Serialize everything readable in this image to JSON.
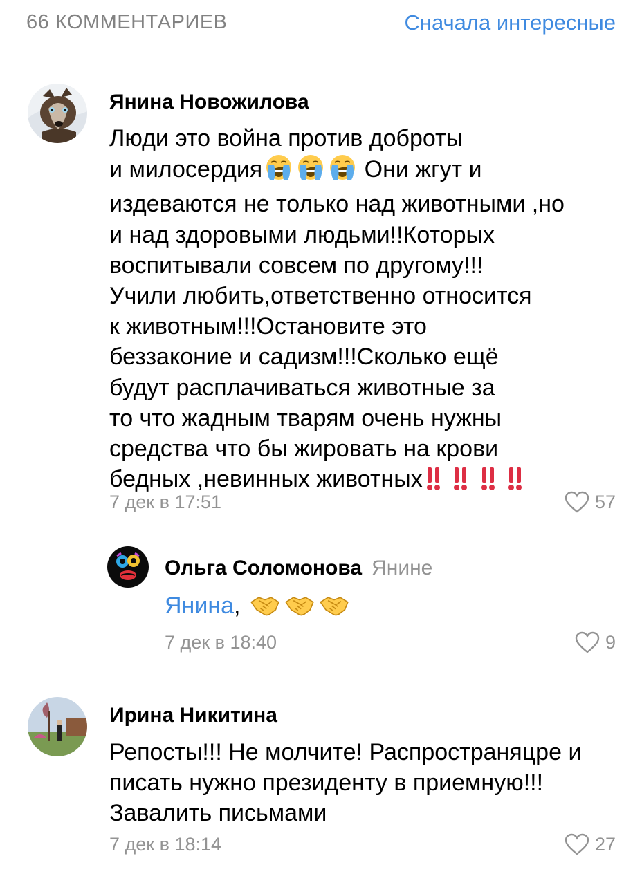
{
  "header": {
    "count": "66 КОММЕНТАРИЕВ",
    "sort": "Сначала интересные"
  },
  "comments": [
    {
      "author": "Янина Новожилова",
      "lines": [
        "Люди это война против доброты",
        "и милосердия",
        "Они жгут и",
        "издеваются не только над животными ,но",
        "и над здоровыми людьми!!Которых",
        "воспитывали совсем по другому!!!",
        "Учили любить,ответственно относится",
        "к животным!!!Остановите это",
        "беззаконие и садизм!!!Сколько ещё",
        "будут расплачиваться животные за",
        "то что жадным тварям очень нужны",
        "средства что бы жировать на крови",
        "бедных ,невинных животных"
      ],
      "emojis": [
        "loudly-crying-face",
        "double-exclamation"
      ],
      "date": "7 дек в 17:51",
      "likes": "57"
    },
    {
      "author": "Ольга Соломонова",
      "reply_to": "Янине",
      "mention": "Янина",
      "text_suffix": ",",
      "emojis": [
        "handshake"
      ],
      "date": "7 дек в 18:40",
      "likes": "9"
    },
    {
      "author": "Ирина Никитина",
      "lines": [
        "Репосты!!! Не молчите! Распространяцре и",
        "писать нужно президенту в приемную!!!",
        "Завалить письмами"
      ],
      "date": "7 дек в 18:14",
      "likes": "27"
    }
  ],
  "colors": {
    "accent": "#3f8ae0",
    "secondary": "#939393",
    "text": "#000000"
  }
}
